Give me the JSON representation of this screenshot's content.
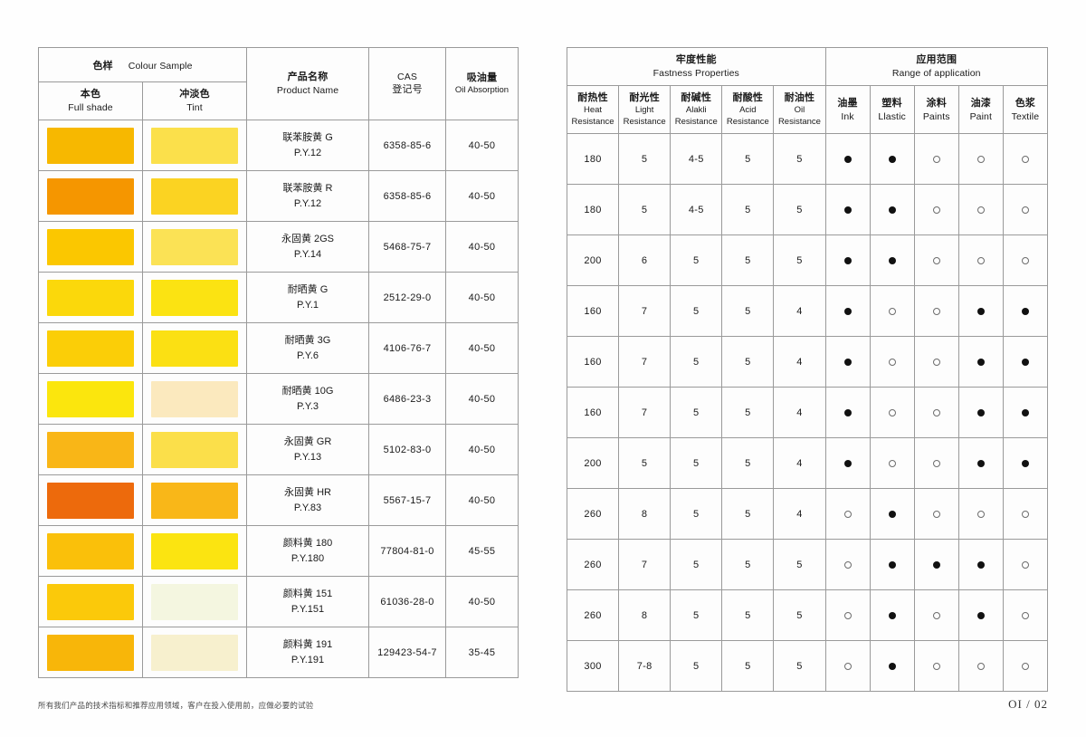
{
  "document": {
    "footnote": "所有我们产品的技术指标和推荐应用领域，客户在投入使用前，应做必要的试验",
    "page_number": "OI / 02"
  },
  "left_table": {
    "headers": {
      "colour_sample_cn": "色样",
      "colour_sample_en": "Colour Sample",
      "full_shade_cn": "本色",
      "full_shade_en": "Full shade",
      "tint_cn": "冲淡色",
      "tint_en": "Tint",
      "product_name_cn": "产品名称",
      "product_name_en": "Product Name",
      "cas_en": "CAS",
      "cas_cn": "登记号",
      "oil_absorption_cn": "吸油量",
      "oil_absorption_en": "Oil Absorption"
    }
  },
  "right_table": {
    "headers": {
      "fastness_cn": "牢度性能",
      "fastness_en": "Fastness Properties",
      "range_cn": "应用范围",
      "range_en": "Range of application",
      "heat_cn": "耐热性",
      "heat_en1": "Heat",
      "heat_en2": "Resistance",
      "light_cn": "耐光性",
      "light_en1": "Light",
      "light_en2": "Resistance",
      "alkali_cn": "耐碱性",
      "alkali_en1": "Alakli",
      "alkali_en2": "Resistance",
      "acid_cn": "耐酸性",
      "acid_en1": "Acid",
      "acid_en2": "Resistance",
      "oil_cn": "耐油性",
      "oil_en1": "Oil",
      "oil_en2": "Resistance",
      "ink_cn": "油墨",
      "ink_en": "Ink",
      "plastic_cn": "塑料",
      "plastic_en": "Llastic",
      "paints_cn": "涂料",
      "paints_en": "Paints",
      "paint_cn": "油漆",
      "paint_en": "Paint",
      "textile_cn": "色浆",
      "textile_en": "Textile"
    }
  },
  "rows": [
    {
      "full_shade_color": "#F7B800",
      "tint_color": "#FBE04B",
      "name_cn": "联苯胺黄 G",
      "name_py": "P.Y.12",
      "cas": "6358-85-6",
      "oil_absorption": "40-50",
      "heat": "180",
      "light": "5",
      "alkali": "4-5",
      "acid": "5",
      "oil": "5",
      "ink": "filled",
      "plastic": "filled",
      "paints": "hollow",
      "paint": "hollow",
      "textile": "hollow"
    },
    {
      "full_shade_color": "#F59600",
      "tint_color": "#FBD322",
      "name_cn": "联苯胺黄 R",
      "name_py": "P.Y.12",
      "cas": "6358-85-6",
      "oil_absorption": "40-50",
      "heat": "180",
      "light": "5",
      "alkali": "4-5",
      "acid": "5",
      "oil": "5",
      "ink": "filled",
      "plastic": "filled",
      "paints": "hollow",
      "paint": "hollow",
      "textile": "hollow"
    },
    {
      "full_shade_color": "#FBC700",
      "tint_color": "#FBE255",
      "name_cn": "永固黄 2GS",
      "name_py": "P.Y.14",
      "cas": "5468-75-7",
      "oil_absorption": "40-50",
      "heat": "200",
      "light": "6",
      "alkali": "5",
      "acid": "5",
      "oil": "5",
      "ink": "filled",
      "plastic": "filled",
      "paints": "hollow",
      "paint": "hollow",
      "textile": "hollow"
    },
    {
      "full_shade_color": "#FBD80B",
      "tint_color": "#FBE312",
      "name_cn": "耐晒黄 G",
      "name_py": "P.Y.1",
      "cas": "2512-29-0",
      "oil_absorption": "40-50",
      "heat": "160",
      "light": "7",
      "alkali": "5",
      "acid": "5",
      "oil": "4",
      "ink": "filled",
      "plastic": "hollow",
      "paints": "hollow",
      "paint": "filled",
      "textile": "filled"
    },
    {
      "full_shade_color": "#FBCE07",
      "tint_color": "#FBE013",
      "name_cn": "耐晒黄 3G",
      "name_py": "P.Y.6",
      "cas": "4106-76-7",
      "oil_absorption": "40-50",
      "heat": "160",
      "light": "7",
      "alkali": "5",
      "acid": "5",
      "oil": "4",
      "ink": "filled",
      "plastic": "hollow",
      "paints": "hollow",
      "paint": "filled",
      "textile": "filled"
    },
    {
      "full_shade_color": "#FBE60D",
      "tint_color": "#FBE9BE",
      "name_cn": "耐晒黄 10G",
      "name_py": "P.Y.3",
      "cas": "6486-23-3",
      "oil_absorption": "40-50",
      "heat": "160",
      "light": "7",
      "alkali": "5",
      "acid": "5",
      "oil": "4",
      "ink": "filled",
      "plastic": "hollow",
      "paints": "hollow",
      "paint": "filled",
      "textile": "filled"
    },
    {
      "full_shade_color": "#F9B617",
      "tint_color": "#FBDF4A",
      "name_cn": "永固黄 GR",
      "name_py": "P.Y.13",
      "cas": "5102-83-0",
      "oil_absorption": "40-50",
      "heat": "200",
      "light": "5",
      "alkali": "5",
      "acid": "5",
      "oil": "4",
      "ink": "filled",
      "plastic": "hollow",
      "paints": "hollow",
      "paint": "filled",
      "textile": "filled"
    },
    {
      "full_shade_color": "#ED6A0C",
      "tint_color": "#F9B718",
      "name_cn": "永固黄 HR",
      "name_py": "P.Y.83",
      "cas": "5567-15-7",
      "oil_absorption": "40-50",
      "heat": "260",
      "light": "8",
      "alkali": "5",
      "acid": "5",
      "oil": "4",
      "ink": "hollow",
      "plastic": "filled",
      "paints": "hollow",
      "paint": "hollow",
      "textile": "hollow"
    },
    {
      "full_shade_color": "#FAC00A",
      "tint_color": "#FBE411",
      "name_cn": "颜料黄 180",
      "name_py": "P.Y.180",
      "cas": "77804-81-0",
      "oil_absorption": "45-55",
      "heat": "260",
      "light": "7",
      "alkali": "5",
      "acid": "5",
      "oil": "5",
      "ink": "hollow",
      "plastic": "filled",
      "paints": "filled",
      "paint": "filled",
      "textile": "hollow"
    },
    {
      "full_shade_color": "#FBC90A",
      "tint_color": "#F4F6E0",
      "name_cn": "颜料黄 151",
      "name_py": "P.Y.151",
      "cas": "61036-28-0",
      "oil_absorption": "40-50",
      "heat": "260",
      "light": "8",
      "alkali": "5",
      "acid": "5",
      "oil": "5",
      "ink": "hollow",
      "plastic": "filled",
      "paints": "hollow",
      "paint": "filled",
      "textile": "hollow"
    },
    {
      "full_shade_color": "#F8B609",
      "tint_color": "#F7F0CE",
      "name_cn": "颜料黄 191",
      "name_py": "P.Y.191",
      "cas": "129423-54-7",
      "oil_absorption": "35-45",
      "heat": "300",
      "light": "7-8",
      "alkali": "5",
      "acid": "5",
      "oil": "5",
      "ink": "hollow",
      "plastic": "filled",
      "paints": "hollow",
      "paint": "hollow",
      "textile": "hollow"
    }
  ]
}
